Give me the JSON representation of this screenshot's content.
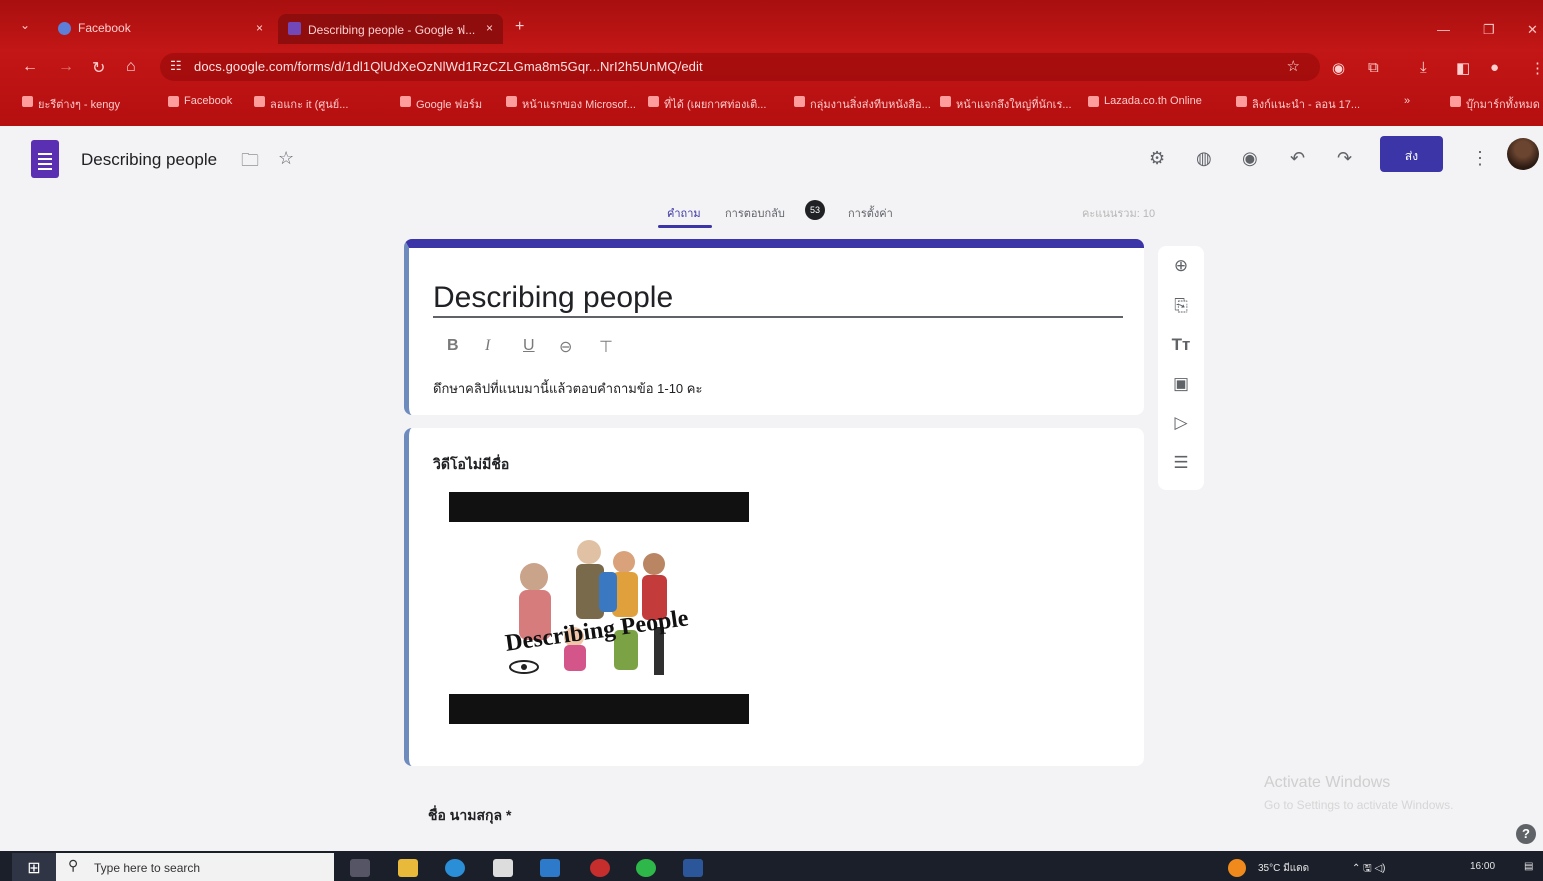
{
  "browser": {
    "tabs": [
      {
        "title": "Facebook",
        "close": "×",
        "active": false
      },
      {
        "title": "Describing people - Google ฟ...",
        "close": "×",
        "active": true
      }
    ],
    "new_tab": "+",
    "url": "docs.google.com/forms/d/1dl1QlUdXeOzNlWd1RzCZLGma8m5Gqr...NrI2h5UnMQ/edit",
    "bookmarks": [
      "ยะรีต่างๆ - kengy",
      "Facebook",
      "ลอแกะ it (ศูนย์...",
      "Google ฟอร์ม",
      "หน้าแรกของ Microsof...",
      "ที่ได้ (เผยกาศท่องเติ...",
      "กลุ่มงานสิ่งส่งทีบหนังสือ...",
      "หน้าแจกลึงใหญ่ที่นักเร...",
      "Lazada.co.th Online",
      "ลิงก์แนะนำ - ลอน 17...",
      "»",
      "บุ๊กมาร์กทั้งหมด"
    ]
  },
  "header": {
    "doc_title": "Describing people",
    "send_label": "ส่ง"
  },
  "subtabs": {
    "questions": "คำถาม",
    "responses": "การตอบกลับ",
    "responses_count": "53",
    "settings": "การตั้งค่า",
    "total_points": "คะแนนรวม: 10"
  },
  "form": {
    "title": "Describing people",
    "formatting": {
      "bold": "B",
      "italic": "I",
      "underline": "U"
    },
    "description": "ดึกษาคลิปที่แนบมานี้แล้วตอบคำถามข้อ 1-10 คะ",
    "video_section_title": "วิดีโอไม่มีชื่อ",
    "video_caption": "Describing People",
    "name_field": "ชื่อ นามสกุล *"
  },
  "watermark": {
    "line1": "Activate Windows",
    "line2": "Go to Settings to activate Windows."
  },
  "taskbar": {
    "search_placeholder": "Type here to search",
    "weather": "35°C มีแดด",
    "time": "16:00"
  },
  "colors": {
    "theme": "#3b35a8",
    "browser_chrome": "#c31616",
    "left_accent": "#6d8bbd"
  }
}
